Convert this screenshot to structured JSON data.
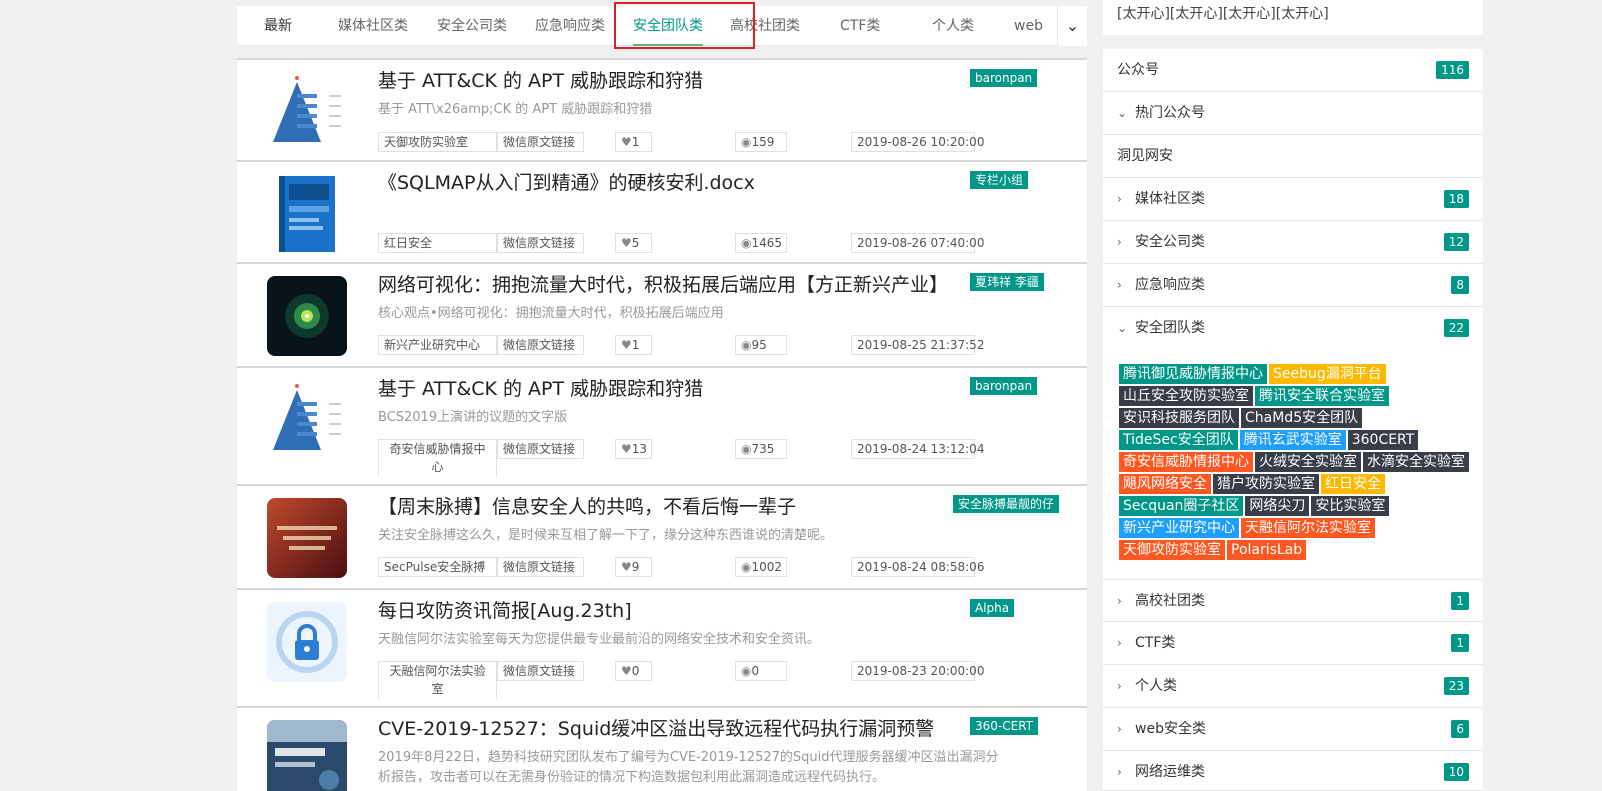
{
  "tabs": [
    {
      "label": "最新"
    },
    {
      "label": "媒体社区类"
    },
    {
      "label": "安全公司类"
    },
    {
      "label": "应急响应类"
    },
    {
      "label": "安全团队类"
    },
    {
      "label": "高校社团类"
    },
    {
      "label": "CTF类"
    },
    {
      "label": "个人类"
    },
    {
      "label": "web"
    }
  ],
  "tabs_more_icon": "chevron-down-icon",
  "active_tab": "安全团队类",
  "articles": [
    {
      "title": "基于 ATT&CK 的 APT 威胁跟踪和狩猎",
      "summary": "基于 ATT\\x26amp;CK 的 APT 威胁跟踪和狩猎",
      "author": "baronpan",
      "source": "天御攻防实验室",
      "link": "微信原文链接",
      "likes": "1",
      "views": "159",
      "date": "2019-08-26 10:20:00",
      "thumb": "pyramid"
    },
    {
      "title": "《SQLMAP从入门到精通》的硬核安利.docx",
      "summary": "",
      "author": "专栏小组",
      "source": "红日安全",
      "link": "微信原文链接",
      "likes": "5",
      "views": "1465",
      "date": "2019-08-26 07:40:00",
      "thumb": "book"
    },
    {
      "title": "网络可视化：拥抱流量大时代，积极拓展后端应用【方正新兴产业】",
      "summary": "核心观点•网络可视化：拥抱流量大时代，积极拓展后端应用",
      "author": "夏玮祥 李疆",
      "source": "新兴产业研究中心",
      "link": "微信原文链接",
      "likes": "1",
      "views": "95",
      "date": "2019-08-25 21:37:52",
      "thumb": "eye"
    },
    {
      "title": "基于 ATT&CK 的 APT 威胁跟踪和狩猎",
      "summary": "BCS2019上演讲的议题的文字版",
      "author": "baronpan",
      "source": "奇安信威胁情报中心",
      "link": "微信原文链接",
      "likes": "13",
      "views": "735",
      "date": "2019-08-24 13:12:04",
      "thumb": "pyramid"
    },
    {
      "title": "【周末脉搏】信息安全人的共鸣，不看后悔一辈子",
      "summary": "关注安全脉搏这么久，是时候来互相了解一下了，缘分这种东西谁说的清楚呢。",
      "author": "安全脉搏最靓的仔",
      "source": "SecPulse安全脉搏",
      "link": "微信原文链接",
      "likes": "9",
      "views": "1002",
      "date": "2019-08-24 08:58:06",
      "thumb": "hacked"
    },
    {
      "title": "每日攻防资讯简报[Aug.23th]",
      "summary": "天融信阿尔法实验室每天为您提供最专业最前沿的网络安全技术和安全资讯。",
      "author": "Alpha",
      "source": "天融信阿尔法实验室",
      "link": "微信原文链接",
      "likes": "0",
      "views": "0",
      "date": "2019-08-23 20:00:00",
      "thumb": "lock"
    },
    {
      "title": "CVE-2019-12527：Squid缓冲区溢出导致远程代码执行漏洞预警",
      "summary": "2019年8月22日，趋势科技研究团队发布了编号为CVE-2019-12527的Squid代理服务器缓冲区溢出漏洞分析报告，攻击者可以在无需身份验证的情况下构造数据包利用此漏洞造成远程代码执行。",
      "author": "360-CERT",
      "source": "",
      "link": "",
      "likes": "",
      "views": "",
      "date": "",
      "thumb": "squid"
    }
  ],
  "sidebar": {
    "emoticons": "[太开心][太开心][太开心][太开心]",
    "header": {
      "label": "公众号",
      "count": "116"
    },
    "hot": {
      "label": "热门公众号"
    },
    "hot_item": "洞见网安",
    "categories": [
      {
        "label": "媒体社区类",
        "count": "18"
      },
      {
        "label": "安全公司类",
        "count": "12"
      },
      {
        "label": "应急响应类",
        "count": "8"
      },
      {
        "label": "安全团队类",
        "count": "22"
      },
      {
        "label": "高校社团类",
        "count": "1"
      },
      {
        "label": "CTF类",
        "count": "1"
      },
      {
        "label": "个人类",
        "count": "23"
      },
      {
        "label": "web安全类",
        "count": "6"
      },
      {
        "label": "网络运维类",
        "count": "10"
      }
    ],
    "team_tags": [
      {
        "label": "腾讯御见威胁情报中心",
        "color": "teal"
      },
      {
        "label": "Seebug漏洞平台",
        "color": "orange"
      },
      {
        "label": "山丘安全攻防实验室",
        "color": "dark"
      },
      {
        "label": "腾讯安全联合实验室",
        "color": "teal"
      },
      {
        "label": "安识科技服务团队",
        "color": "dark"
      },
      {
        "label": "ChaMd5安全团队",
        "color": "dark"
      },
      {
        "label": "TideSec安全团队",
        "color": "teal"
      },
      {
        "label": "腾讯玄武实验室",
        "color": "blue"
      },
      {
        "label": "360CERT",
        "color": "dark"
      },
      {
        "label": "奇安信威胁情报中心",
        "color": "red"
      },
      {
        "label": "火绒安全实验室",
        "color": "dark"
      },
      {
        "label": "水滴安全实验室",
        "color": "dark"
      },
      {
        "label": "飓风网络安全",
        "color": "red"
      },
      {
        "label": "猎户攻防实验室",
        "color": "dark"
      },
      {
        "label": "红日安全",
        "color": "orange"
      },
      {
        "label": "Secquan圈子社区",
        "color": "teal"
      },
      {
        "label": "网络尖刀",
        "color": "dark"
      },
      {
        "label": "安比实验室",
        "color": "dark"
      },
      {
        "label": "新兴产业研究中心",
        "color": "blue"
      },
      {
        "label": "天融信阿尔法实验室",
        "color": "red"
      },
      {
        "label": "天御攻防实验室",
        "color": "red"
      },
      {
        "label": "PolarisLab",
        "color": "red"
      }
    ]
  },
  "colors": {
    "accent": "#009688",
    "tab_active_line": "#5fb878",
    "highlight_box": "#e02020",
    "tag_orange": "#ffb800",
    "tag_dark": "#393d49",
    "tag_red": "#ff5722",
    "tag_blue": "#1e9fff"
  }
}
